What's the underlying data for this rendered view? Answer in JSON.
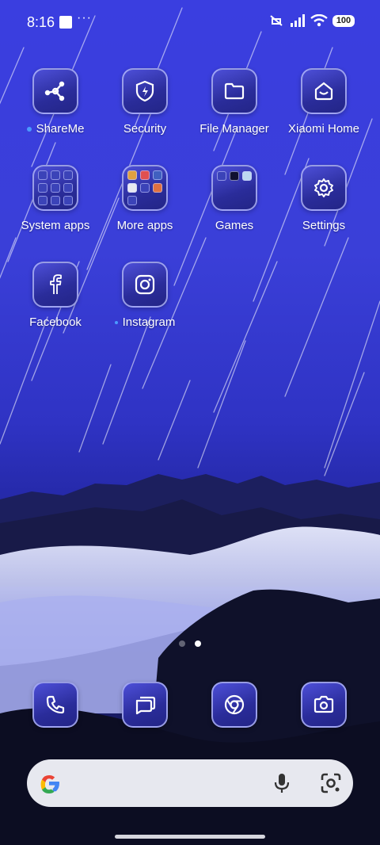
{
  "status_bar": {
    "time": "8:16",
    "overflow": "···",
    "battery": "100"
  },
  "apps": [
    {
      "label": "ShareMe",
      "icon": "shareme-icon",
      "notification_dot": true
    },
    {
      "label": "Security",
      "icon": "shield-icon"
    },
    {
      "label": "File Manager",
      "icon": "folder-icon"
    },
    {
      "label": "Xiaomi Home",
      "icon": "xiaomi-home-icon"
    },
    {
      "label": "System apps",
      "icon": "folder-grid-icon"
    },
    {
      "label": "More apps",
      "icon": "folder-grid-icon"
    },
    {
      "label": "Games",
      "icon": "folder-grid-icon"
    },
    {
      "label": "Settings",
      "icon": "gear-icon"
    },
    {
      "label": "Facebook",
      "icon": "facebook-icon"
    },
    {
      "label": "Instagram",
      "icon": "instagram-icon"
    }
  ],
  "page_indicator": {
    "pages": 2,
    "active": 2
  },
  "dock": [
    {
      "icon": "phone-icon"
    },
    {
      "icon": "messages-icon"
    },
    {
      "icon": "chrome-icon"
    },
    {
      "icon": "camera-icon"
    }
  ],
  "search": {
    "logo": "G"
  },
  "colors": {
    "icon_bg": "#2a2c9a",
    "icon_border": "#bec3ff",
    "search_bg": "#e7e8ef"
  }
}
